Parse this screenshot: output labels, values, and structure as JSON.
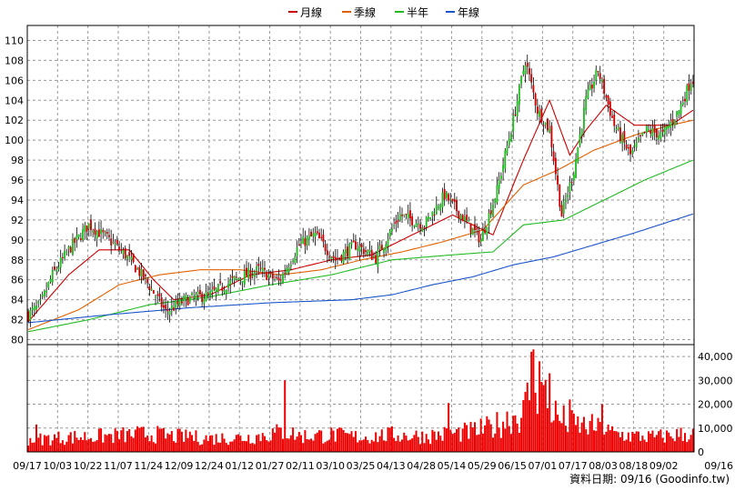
{
  "chart_data": [
    {
      "type": "candlestick",
      "legend": [
        {
          "label": "月線",
          "color": "#cc0000"
        },
        {
          "label": "季線",
          "color": "#e06000"
        },
        {
          "label": "半年",
          "color": "#22bb22"
        },
        {
          "label": "年線",
          "color": "#1a55cc"
        }
      ],
      "y_ticks": [
        80,
        82,
        84,
        86,
        88,
        90,
        92,
        94,
        96,
        98,
        100,
        102,
        104,
        106,
        108,
        110
      ],
      "ylim": [
        79.5,
        111.5
      ],
      "x_ticks": [
        "09/17",
        "10/03",
        "10/22",
        "11/07",
        "11/24",
        "12/09",
        "12/24",
        "01/12",
        "01/27",
        "02/11",
        "03/10",
        "03/25",
        "04/13",
        "04/28",
        "05/14",
        "05/29",
        "06/15",
        "07/01",
        "07/17",
        "08/03",
        "08/18",
        "09/02",
        "09/16"
      ],
      "up_color": "#22bb22",
      "down_color": "#cc0000",
      "grid": true,
      "close_anchors": [
        [
          0,
          82.5
        ],
        [
          6,
          83.5
        ],
        [
          12,
          86.5
        ],
        [
          20,
          89.0
        ],
        [
          30,
          91.5
        ],
        [
          40,
          90.0
        ],
        [
          48,
          88.5
        ],
        [
          58,
          86.0
        ],
        [
          68,
          82.8
        ],
        [
          78,
          84.0
        ],
        [
          90,
          84.5
        ],
        [
          102,
          86.0
        ],
        [
          114,
          87.0
        ],
        [
          124,
          85.8
        ],
        [
          134,
          89.5
        ],
        [
          142,
          90.5
        ],
        [
          152,
          88.0
        ],
        [
          162,
          89.5
        ],
        [
          172,
          88.2
        ],
        [
          184,
          92.5
        ],
        [
          196,
          91.5
        ],
        [
          206,
          94.5
        ],
        [
          216,
          92.0
        ],
        [
          224,
          90.0
        ],
        [
          232,
          95.0
        ],
        [
          240,
          102.0
        ],
        [
          246,
          108.0
        ],
        [
          252,
          103.0
        ],
        [
          258,
          101.0
        ],
        [
          264,
          92.5
        ],
        [
          270,
          97.0
        ],
        [
          276,
          104.0
        ],
        [
          282,
          107.0
        ],
        [
          290,
          101.5
        ],
        [
          298,
          98.5
        ],
        [
          306,
          101.0
        ],
        [
          314,
          100.5
        ],
        [
          322,
          103.0
        ],
        [
          328,
          106.0
        ]
      ],
      "ma": {
        "month": [
          [
            0,
            81.8
          ],
          [
            20,
            86.5
          ],
          [
            35,
            89.0
          ],
          [
            50,
            89.0
          ],
          [
            62,
            86.0
          ],
          [
            72,
            84.0
          ],
          [
            90,
            84.5
          ],
          [
            110,
            86.5
          ],
          [
            130,
            87.0
          ],
          [
            150,
            88.0
          ],
          [
            170,
            88.5
          ],
          [
            190,
            90.5
          ],
          [
            210,
            92.5
          ],
          [
            230,
            90.5
          ],
          [
            245,
            98.0
          ],
          [
            258,
            104.0
          ],
          [
            268,
            98.5
          ],
          [
            276,
            101.0
          ],
          [
            286,
            103.5
          ],
          [
            300,
            101.5
          ],
          [
            318,
            101.5
          ],
          [
            329,
            103.0
          ]
        ],
        "quarter": [
          [
            0,
            81.0
          ],
          [
            25,
            83.0
          ],
          [
            45,
            85.5
          ],
          [
            65,
            86.5
          ],
          [
            85,
            87.0
          ],
          [
            105,
            87.0
          ],
          [
            125,
            86.5
          ],
          [
            145,
            87.0
          ],
          [
            165,
            88.0
          ],
          [
            185,
            88.8
          ],
          [
            205,
            89.8
          ],
          [
            225,
            91.0
          ],
          [
            245,
            95.5
          ],
          [
            262,
            97.0
          ],
          [
            280,
            99.0
          ],
          [
            300,
            100.5
          ],
          [
            318,
            101.5
          ],
          [
            329,
            102.0
          ]
        ],
        "half": [
          [
            0,
            80.8
          ],
          [
            30,
            82.0
          ],
          [
            60,
            83.5
          ],
          [
            90,
            84.3
          ],
          [
            120,
            85.5
          ],
          [
            150,
            86.5
          ],
          [
            180,
            88.0
          ],
          [
            210,
            88.5
          ],
          [
            230,
            88.8
          ],
          [
            245,
            91.5
          ],
          [
            265,
            92.0
          ],
          [
            285,
            94.0
          ],
          [
            305,
            96.0
          ],
          [
            329,
            98.0
          ]
        ],
        "year": [
          [
            0,
            81.7
          ],
          [
            40,
            82.5
          ],
          [
            80,
            83.2
          ],
          [
            120,
            83.7
          ],
          [
            160,
            84.0
          ],
          [
            180,
            84.5
          ],
          [
            200,
            85.5
          ],
          [
            220,
            86.3
          ],
          [
            240,
            87.5
          ],
          [
            260,
            88.3
          ],
          [
            280,
            89.5
          ],
          [
            300,
            90.7
          ],
          [
            329,
            92.6
          ]
        ]
      }
    },
    {
      "type": "bar",
      "name": "volume",
      "y_ticks": [
        0,
        10000,
        20000,
        30000,
        40000
      ],
      "y_tick_labels": [
        "0",
        "10,000",
        "20,000",
        "30,000",
        "40,000"
      ],
      "ylim": [
        0,
        45000
      ],
      "color": "#ee0000",
      "anchors": [
        [
          0,
          5500
        ],
        [
          20,
          6500
        ],
        [
          40,
          7000
        ],
        [
          60,
          8000
        ],
        [
          70,
          7000
        ],
        [
          90,
          6000
        ],
        [
          110,
          6500
        ],
        [
          127,
          9000
        ],
        [
          135,
          7000
        ],
        [
          150,
          7500
        ],
        [
          165,
          6500
        ],
        [
          180,
          7500
        ],
        [
          195,
          7000
        ],
        [
          210,
          8000
        ],
        [
          220,
          9000
        ],
        [
          230,
          11000
        ],
        [
          238,
          15000
        ],
        [
          245,
          17000
        ],
        [
          250,
          32000
        ],
        [
          255,
          26000
        ],
        [
          262,
          15000
        ],
        [
          270,
          12000
        ],
        [
          280,
          11000
        ],
        [
          290,
          8000
        ],
        [
          300,
          7000
        ],
        [
          310,
          6500
        ],
        [
          320,
          7500
        ],
        [
          329,
          8000
        ]
      ],
      "spikes": [
        [
          4,
          11500
        ],
        [
          80,
          8500
        ],
        [
          127,
          30000
        ],
        [
          208,
          20500
        ],
        [
          249,
          42000
        ],
        [
          250,
          43000
        ],
        [
          253,
          38000
        ],
        [
          258,
          33000
        ],
        [
          268,
          22000
        ],
        [
          284,
          20000
        ]
      ]
    }
  ],
  "footer": {
    "prefix": "資料日期: ",
    "date": "09/16",
    "source": "(Goodinfo.tw)"
  }
}
